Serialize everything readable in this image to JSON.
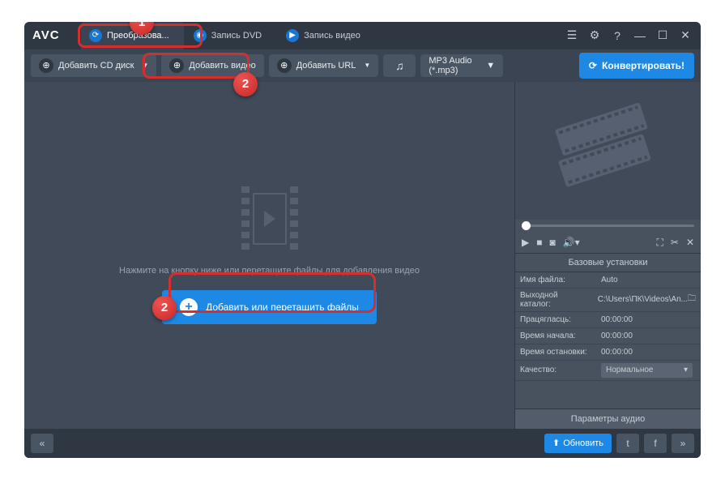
{
  "app": {
    "logo": "AVC"
  },
  "tabs": [
    {
      "label": "Преобразова...",
      "icon": "refresh"
    },
    {
      "label": "Запись DVD",
      "icon": "disc"
    },
    {
      "label": "Запись видео",
      "icon": "play"
    }
  ],
  "toolbar": {
    "add_cd": "Добавить CD диск",
    "add_video": "Добавить видео",
    "add_url": "Добавить URL",
    "format": "MP3 Audio (*.mp3)",
    "convert": "Конвертировать!"
  },
  "drop": {
    "hint": "Нажмите на кнопку ниже или перетащите файлы для добавления видео",
    "add_btn": "Добавить или перетащить файлы"
  },
  "settings": {
    "header": "Базовые установки",
    "filename_lbl": "Имя файла:",
    "filename_val": "Auto",
    "output_lbl": "Выходной каталог:",
    "output_val": "C:\\Users\\ПК\\Videos\\An...",
    "duration_lbl": "Працягласць:",
    "duration_val": "00:00:00",
    "start_lbl": "Время начала:",
    "start_val": "00:00:00",
    "stop_lbl": "Время остановки:",
    "stop_val": "00:00:00",
    "quality_lbl": "Качество:",
    "quality_val": "Нормальное"
  },
  "audio_params": "Параметры аудио",
  "footer": {
    "update": "Обновить"
  },
  "badges": {
    "b1": "1",
    "b2a": "2",
    "b2b": "2"
  }
}
